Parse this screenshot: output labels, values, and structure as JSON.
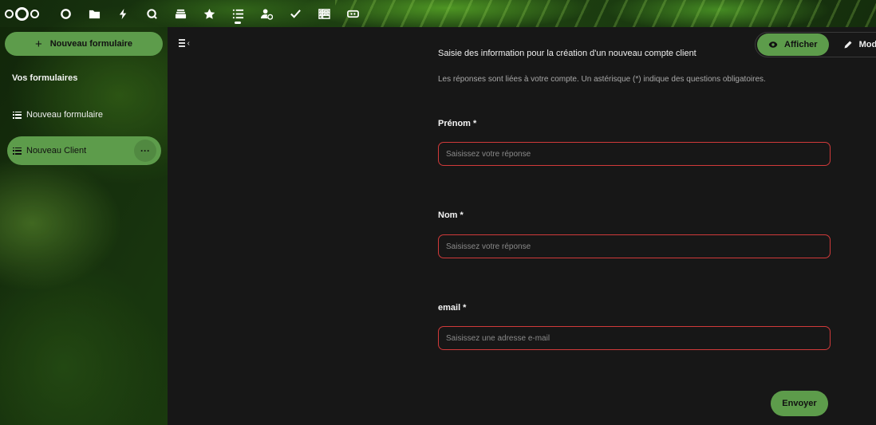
{
  "header": {
    "apps": [
      {
        "name": "dashboard-icon"
      },
      {
        "name": "files-icon"
      },
      {
        "name": "activity-icon"
      },
      {
        "name": "talk-icon"
      },
      {
        "name": "deck-icon"
      },
      {
        "name": "favorites-icon"
      },
      {
        "name": "forms-icon",
        "active": true
      },
      {
        "name": "contacts-icon"
      },
      {
        "name": "tasks-icon"
      },
      {
        "name": "tables-icon"
      },
      {
        "name": "ticket-icon"
      }
    ]
  },
  "sidebar": {
    "new_form_label": "Nouveau formulaire",
    "caption": "Vos formulaires",
    "items": [
      {
        "label": "Nouveau formulaire",
        "active": false
      },
      {
        "label": "Nouveau Client",
        "active": true,
        "more": "···"
      }
    ]
  },
  "main": {
    "view_switch": {
      "view_label": "Afficher",
      "edit_label": "Modifier"
    },
    "description": "Saisie des information pour la création d'un nouveau compte client",
    "note": "Les réponses sont liées à votre compte. Un astérisque (*) indique des questions obligatoires.",
    "questions": [
      {
        "label": "Prénom *",
        "placeholder": "Saisissez votre réponse"
      },
      {
        "label": "Nom *",
        "placeholder": "Saisissez votre réponse"
      },
      {
        "label": "email *",
        "placeholder": "Saisissez une adresse e-mail"
      }
    ],
    "submit_label": "Envoyer"
  },
  "colors": {
    "accent": "#5d9c4b",
    "required_border": "#d13a3a",
    "main_bg": "#171717"
  }
}
